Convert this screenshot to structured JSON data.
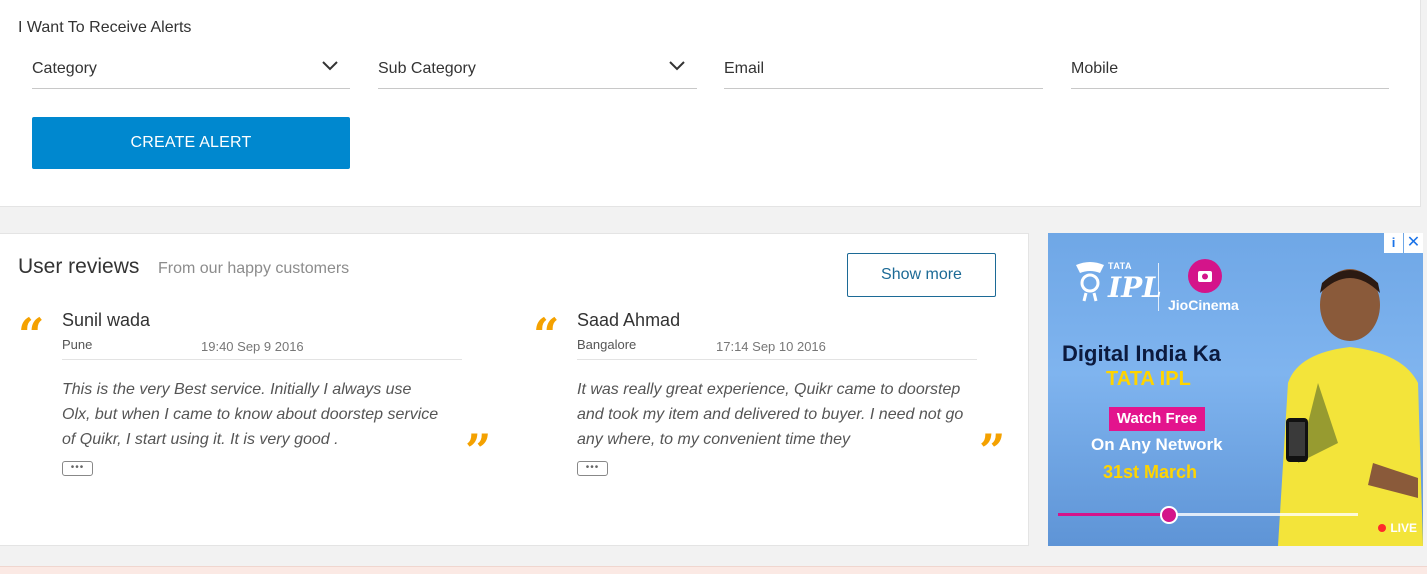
{
  "alerts": {
    "title": "I Want To Receive Alerts",
    "category_label": "Category",
    "subcategory_label": "Sub Category",
    "email_label": "Email",
    "mobile_label": "Mobile",
    "create_button": "CREATE ALERT"
  },
  "reviews": {
    "title": "User reviews",
    "subtitle": "From our happy customers",
    "show_more": "Show more",
    "items": [
      {
        "name": "Sunil wada",
        "city": "Pune",
        "time": "19:40 Sep 9 2016",
        "text": "This is the very Best service. Initially I always use Olx, but when I came to know about doorstep service of Quikr, I start using it. It is very good .",
        "more": "•••"
      },
      {
        "name": "Saad Ahmad",
        "city": "Bangalore",
        "time": "17:14 Sep 10 2016",
        "text": "It was really great experience, Quikr came to doorstep and took my item and delivered to buyer. I need not go any where, to my convenient time they",
        "more": "•••"
      }
    ],
    "open_quote": "“",
    "close_quote": "”"
  },
  "ad": {
    "info": "i",
    "close": "✕",
    "tata": "TATA",
    "ipl": "IPL",
    "jiocinema": "JioCinema",
    "headline1": "Digital India Ka",
    "headline2": "TATA IPL",
    "watch_free": "Watch Free",
    "network": "On Any Network",
    "date": "31st March",
    "live": "LIVE",
    "seek_progress": 0.37
  },
  "colors": {
    "primary_button": "#0088cf",
    "quote": "#f4a100",
    "outline_button": "#1c6a96",
    "jio_pink": "#d4148a"
  }
}
